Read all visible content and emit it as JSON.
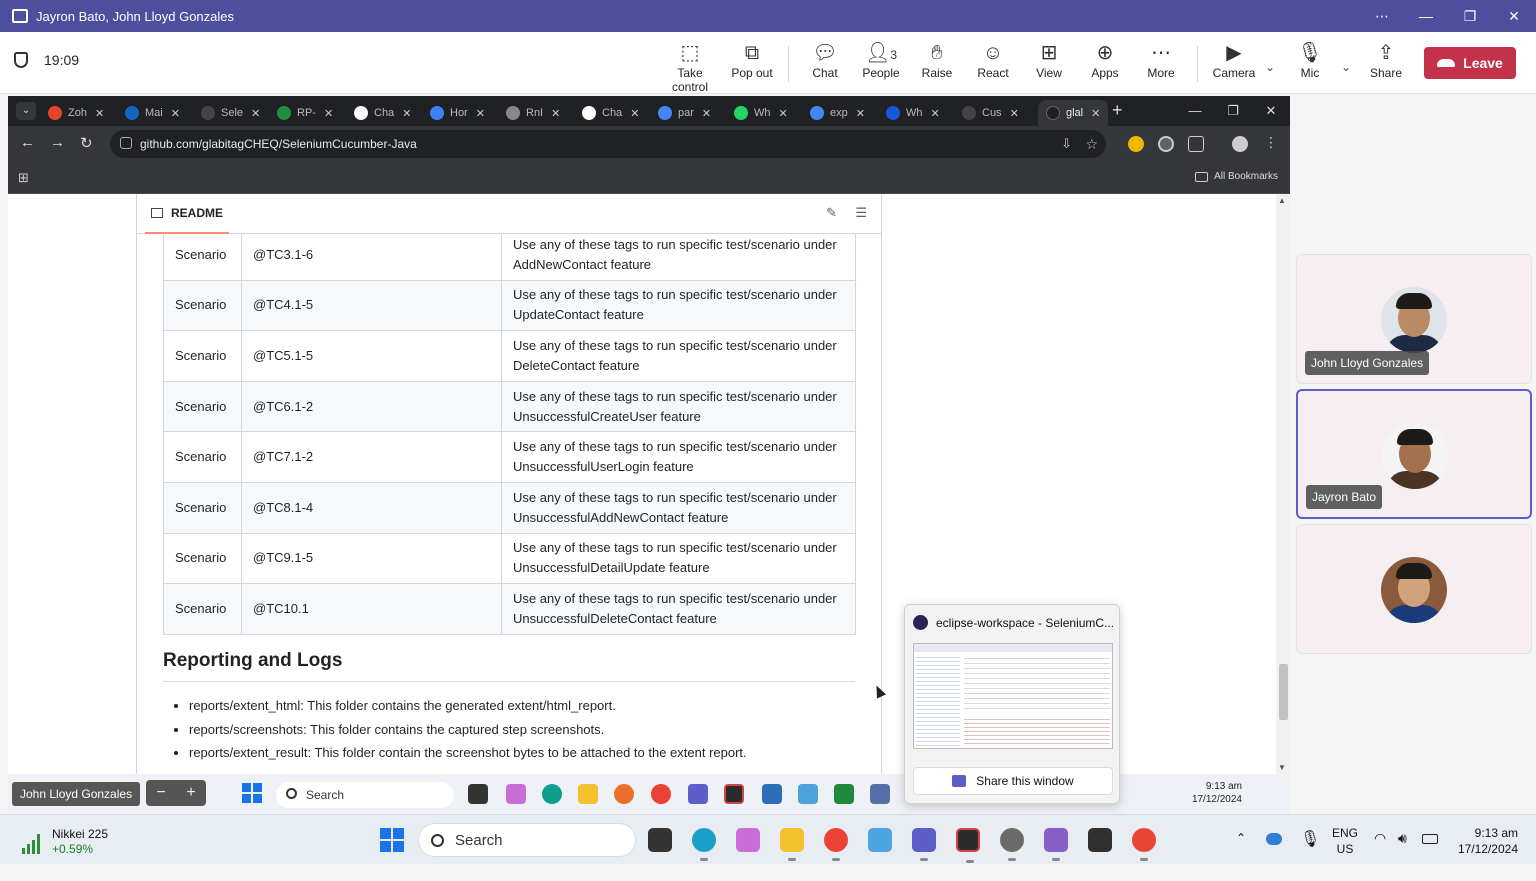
{
  "teams": {
    "window_title": "Jayron Bato, John Lloyd Gonzales",
    "timer": "19:09",
    "toolbar": {
      "take_control": "Take control",
      "pop_out": "Pop out",
      "chat": "Chat",
      "people": "People",
      "people_count": "3",
      "raise": "Raise",
      "react": "React",
      "view": "View",
      "apps": "Apps",
      "more": "More",
      "camera": "Camera",
      "mic": "Mic",
      "share": "Share",
      "leave": "Leave"
    }
  },
  "chrome": {
    "tabs": [
      {
        "label": "Zoh",
        "color": "#e2462c"
      },
      {
        "label": "Mai",
        "color": "#1565c0"
      },
      {
        "label": "Sele",
        "color": "#444444"
      },
      {
        "label": "RP-",
        "color": "#1e8e3e"
      },
      {
        "label": "Cha",
        "color": "#ffffff"
      },
      {
        "label": "Hor",
        "color": "#3b82f6"
      },
      {
        "label": "RnI",
        "color": "#888888"
      },
      {
        "label": "Cha",
        "color": "#ffffff"
      },
      {
        "label": "par",
        "color": "#4285f4"
      },
      {
        "label": "Wh",
        "color": "#25d366"
      },
      {
        "label": "exp",
        "color": "#4285f4"
      },
      {
        "label": "Wh",
        "color": "#1a56db"
      },
      {
        "label": "Cus",
        "color": "#444444"
      }
    ],
    "active_tab": "glal",
    "url": "github.com/glabitagCHEQ/SeleniumCucumber-Java",
    "all_bookmarks": "All Bookmarks"
  },
  "readme": {
    "tab_label": "README",
    "rows": [
      {
        "type": "Scenario",
        "tag": "@TC3.1-6",
        "desc1": "Use any of these tags to run specific test/scenario under",
        "desc2": "AddNewContact feature"
      },
      {
        "type": "Scenario",
        "tag": "@TC4.1-5",
        "desc1": "Use any of these tags to run specific test/scenario under",
        "desc2": "UpdateContact feature"
      },
      {
        "type": "Scenario",
        "tag": "@TC5.1-5",
        "desc1": "Use any of these tags to run specific test/scenario under",
        "desc2": "DeleteContact feature"
      },
      {
        "type": "Scenario",
        "tag": "@TC6.1-2",
        "desc1": "Use any of these tags to run specific test/scenario under",
        "desc2": "UnsuccessfulCreateUser feature"
      },
      {
        "type": "Scenario",
        "tag": "@TC7.1-2",
        "desc1": "Use any of these tags to run specific test/scenario under",
        "desc2": "UnsuccessfulUserLogin feature"
      },
      {
        "type": "Scenario",
        "tag": "@TC8.1-4",
        "desc1": "Use any of these tags to run specific test/scenario under",
        "desc2": "UnsuccessfulAddNewContact feature"
      },
      {
        "type": "Scenario",
        "tag": "@TC9.1-5",
        "desc1": "Use any of these tags to run specific test/scenario under",
        "desc2": "UnsuccessfulDetailUpdate feature"
      },
      {
        "type": "Scenario",
        "tag": "@TC10.1",
        "desc1": "Use any of these tags to run specific test/scenario under",
        "desc2": "UnsuccessfulDeleteContact feature"
      }
    ],
    "section_title": "Reporting and Logs",
    "bullets": [
      "reports/extent_html: This folder contains the generated extent/html_report.",
      "reports/screenshots: This folder contains the captured step screenshots.",
      "reports/extent_result: This folder contain the screenshot bytes to be attached to the extent report."
    ]
  },
  "preview": {
    "title": "eclipse-workspace - SeleniumC...",
    "share_label": "Share this window"
  },
  "remote_taskbar": {
    "presenter_name": "John Lloyd Gonzales",
    "zoom_minus": "−",
    "zoom_plus": "+",
    "search": "Search",
    "time": "9:13 am",
    "date": "17/12/2024"
  },
  "gallery": {
    "participants": [
      {
        "name": "John Lloyd Gonzales"
      },
      {
        "name": "Jayron Bato"
      },
      {
        "name": ""
      }
    ]
  },
  "taskbar": {
    "widget_name": "Nikkei 225",
    "widget_change": "+0.59%",
    "search": "Search",
    "lang1": "ENG",
    "lang2": "US",
    "time": "9:13 am",
    "date": "17/12/2024"
  }
}
